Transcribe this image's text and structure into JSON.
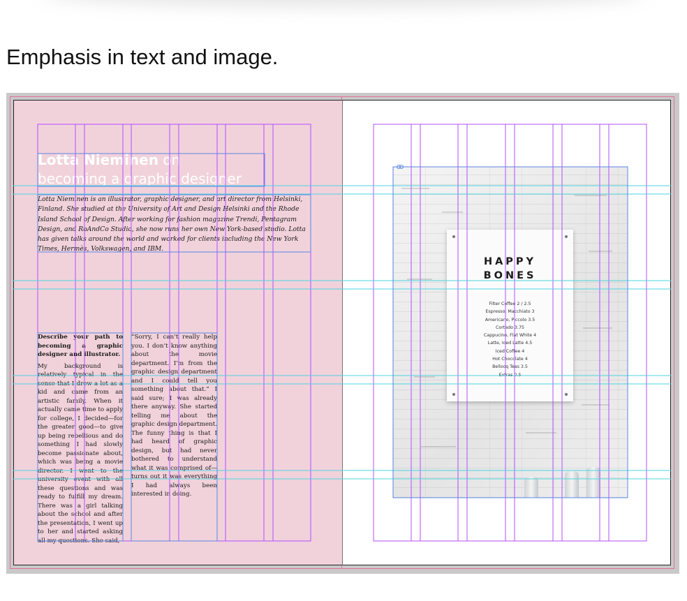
{
  "heading": "Emphasis in text and image.",
  "left_page": {
    "title_bold": "Lotta Nieminen",
    "title_rest": " on",
    "title_line2": "becoming a graphic designer",
    "intro": "Lotta Nieminen is an illustrator, graphic designer, and art director from Helsinki, Finland. She studied at the University of Art and Design Helsinki and the Rhode Island School of Design. After working for fashion magazine Trendi, Pentagram Design, and RoAndCo Studio, she now runs her own New York-based studio. Lotta has given talks around the world and worked for clients including the New York Times, Hermès, Volkswagen, and IBM.",
    "question": "Describe your path to becoming a graphic designer and illustrator.",
    "answer_col1": "My background is relatively typical in the sense that I drew a lot as a kid and came from an artistic family. When it actually came time to apply for college, I decided—for the greater good—to give up being rebellious and do something I had slowly become passionate about, which was being a movie director. I went to the university event with all these questions and was ready to fulfill my dream. There was a girl talking about the school and after the presentation, I went up to her and started asking all my questions. She said,",
    "answer_col2": "“Sorry, I can’t really help you. I don’t know anything about the movie department. I’m from the graphic design department and I could tell you something about that.” I said sure; I was already there anyway. She started telling me about the graphic design department. The funny thing is that I had heard of graphic design, but had never bothered to understand what it was comprised of—turns out it was everything I had always been interested in doing."
  },
  "right_page": {
    "sign_line1": "HAPPY",
    "sign_line2": "BONES",
    "menu": [
      "Filter Coffee 2 / 2.5",
      "Espresso, Macchiato 3",
      "Americano, Piccolo 3.5",
      "Cortado 3.75",
      "Cappucino, Flat White 4",
      "Latte, Iced Latte 4.5",
      "Iced Coffee 4",
      "Hot Chocolate 4",
      "Bellocq Teas 3.5",
      "Extras 0.5"
    ]
  },
  "colors": {
    "left_page_bg": "#f1d2db",
    "margin_guide": "#b44cff",
    "horizontal_guide": "#4ed3e0",
    "bleed": "#e36f9b",
    "frame": "#5b86e5"
  }
}
